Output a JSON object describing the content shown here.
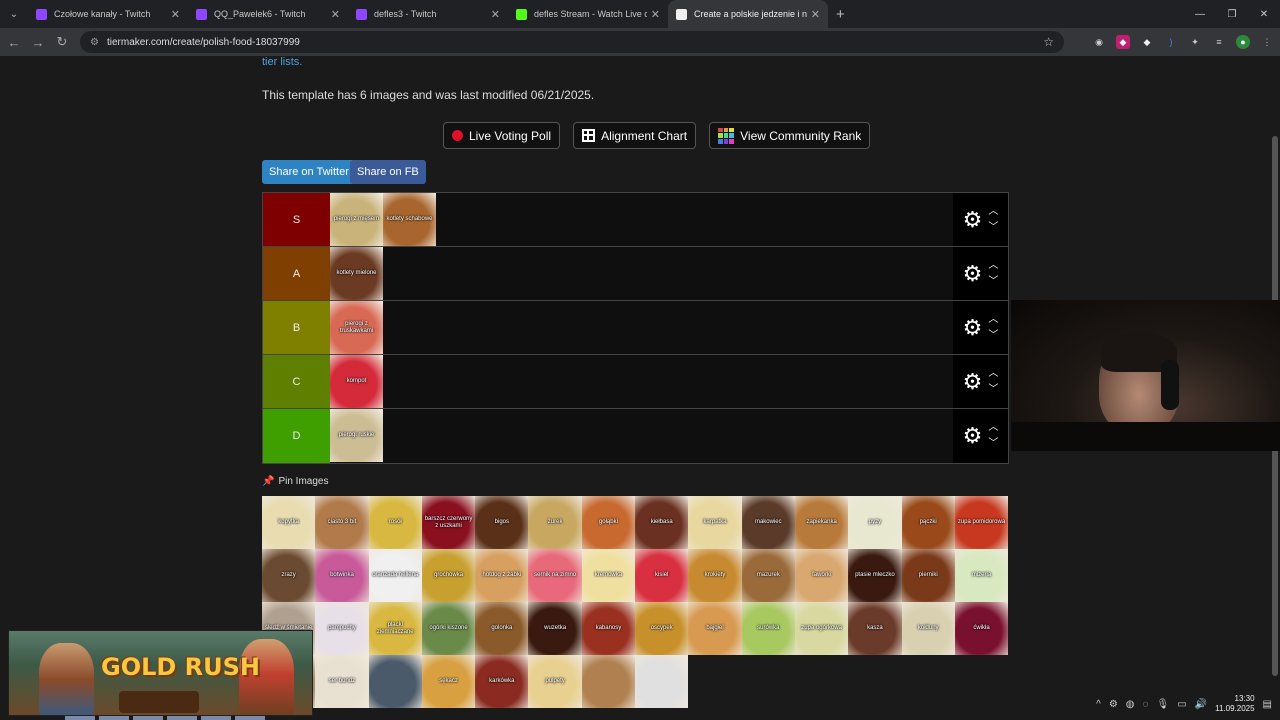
{
  "browser": {
    "tabs": [
      {
        "title": "Czołowe kanały - Twitch",
        "color": "#9146ff",
        "active": false
      },
      {
        "title": "QQ_Pawelek6 - Twitch",
        "color": "#9146ff",
        "active": false
      },
      {
        "title": "defles3 - Twitch",
        "color": "#9146ff",
        "active": false
      },
      {
        "title": "defles Stream - Watch Live on K",
        "color": "#53fc18",
        "active": false
      },
      {
        "title": "Create a polskie jedzenie i napo",
        "color": "#f0f0f0",
        "active": true
      }
    ],
    "url": "tiermaker.com/create/polish-food-18037999"
  },
  "page": {
    "tier_lists_link": "tier lists.",
    "info_text": "This template has 6 images and was last modified 06/21/2025.",
    "buttons": {
      "live_voting": "Live Voting Poll",
      "alignment": "Alignment Chart",
      "community_rank": "View Community Rank"
    },
    "share": {
      "twitter": "Share on Twitter",
      "facebook": "Share on FB"
    },
    "pin_label": "Pin Images"
  },
  "tiers": [
    {
      "label": "S",
      "color": "#7f0000",
      "items": [
        {
          "caption": "pierogi z mięsem",
          "bg": "#c9b37a"
        },
        {
          "caption": "kotlety schabowe",
          "bg": "#a8662e"
        }
      ]
    },
    {
      "label": "A",
      "color": "#7f3f00",
      "items": [
        {
          "caption": "kotlety mielone",
          "bg": "#6b3a22"
        }
      ]
    },
    {
      "label": "B",
      "color": "#7f7f00",
      "items": [
        {
          "caption": "pierogi z truskawkami",
          "bg": "#d86a55"
        }
      ]
    },
    {
      "label": "C",
      "color": "#5f7f00",
      "items": [
        {
          "caption": "kompot",
          "bg": "#d42a3a"
        }
      ]
    },
    {
      "label": "D",
      "color": "#3f9f00",
      "items": [
        {
          "caption": "pierogi ruskie",
          "bg": "#cdbd95"
        }
      ]
    }
  ],
  "pool": [
    {
      "caption": "kopytka",
      "bg": "#e8dcb0"
    },
    {
      "caption": "ciasto 3 bit",
      "bg": "#b07a4a"
    },
    {
      "caption": "rosół",
      "bg": "#d8b840"
    },
    {
      "caption": "barszcz czerwony z uszkami",
      "bg": "#8a1020"
    },
    {
      "caption": "bigos",
      "bg": "#5a3018"
    },
    {
      "caption": "żurek",
      "bg": "#c8a860"
    },
    {
      "caption": "gołąbki",
      "bg": "#c86a30"
    },
    {
      "caption": "kiełbasa",
      "bg": "#6a3022"
    },
    {
      "caption": "karpatka",
      "bg": "#e8d8a0"
    },
    {
      "caption": "makowiec",
      "bg": "#5a3a28"
    },
    {
      "caption": "zapiekanka",
      "bg": "#b87a3a"
    },
    {
      "caption": "pyzy",
      "bg": "#e8e8d0"
    },
    {
      "caption": "pączki",
      "bg": "#9a4a1a"
    },
    {
      "caption": "zupa pomidorowa",
      "bg": "#c83820"
    },
    {
      "caption": "zrazy",
      "bg": "#6a4a30"
    },
    {
      "caption": "botwinka",
      "bg": "#c85a9a"
    },
    {
      "caption": "oranżada hellena",
      "bg": "#f0f0f0"
    },
    {
      "caption": "grochówka",
      "bg": "#c8a030"
    },
    {
      "caption": "hotdog z żabki",
      "bg": "#d8a060"
    },
    {
      "caption": "sernik na zimno",
      "bg": "#e86a7a"
    },
    {
      "caption": "kremówka",
      "bg": "#f0e0a0"
    },
    {
      "caption": "kisiel",
      "bg": "#d83040"
    },
    {
      "caption": "krokiety",
      "bg": "#c88a30"
    },
    {
      "caption": "mazurek",
      "bg": "#9a6a3a"
    },
    {
      "caption": "faworki",
      "bg": "#d8a870"
    },
    {
      "caption": "ptasie mleczko",
      "bg": "#3a1a10"
    },
    {
      "caption": "pierniki",
      "bg": "#7a3a1a"
    },
    {
      "caption": "mizeria",
      "bg": "#d8e8c0"
    },
    {
      "caption": "śledź w śmietanie",
      "bg": "#b0a090"
    },
    {
      "caption": "pampuchy",
      "bg": "#e8e0e8"
    },
    {
      "caption": "placki ziemniaczane",
      "bg": "#d8b840"
    },
    {
      "caption": "ogórki kiszone",
      "bg": "#6a8a4a"
    },
    {
      "caption": "golonka",
      "bg": "#8a5a2a"
    },
    {
      "caption": "wuzetka",
      "bg": "#3a1a10"
    },
    {
      "caption": "kabanosy",
      "bg": "#9a3020"
    },
    {
      "caption": "oscypek",
      "bg": "#c8902a"
    },
    {
      "caption": "bajgiel",
      "bg": "#d89a50"
    },
    {
      "caption": "surówka",
      "bg": "#a8c860"
    },
    {
      "caption": "zupa ogórkowa",
      "bg": "#d8d8a0"
    },
    {
      "caption": "kasza",
      "bg": "#6a3a2a"
    },
    {
      "caption": "kołduny",
      "bg": "#d8d0b0"
    },
    {
      "caption": "ćwikła",
      "bg": "#7a1030"
    },
    {
      "caption": "",
      "bg": "#8a6a40"
    },
    {
      "caption": "ser bundz",
      "bg": "#e8e0d0"
    },
    {
      "caption": "",
      "bg": "#4a5a6a"
    },
    {
      "caption": "sękacz",
      "bg": "#d8a040"
    },
    {
      "caption": "karkówka",
      "bg": "#8a2a20"
    },
    {
      "caption": "pulpety",
      "bg": "#e8d090"
    },
    {
      "caption": "",
      "bg": "#b08050"
    },
    {
      "caption": "",
      "bg": "#e0e0e0"
    }
  ],
  "overlay": {
    "game_title": "GOLD RUSH"
  },
  "system": {
    "time": "13:30",
    "date": "11.09.2025"
  }
}
